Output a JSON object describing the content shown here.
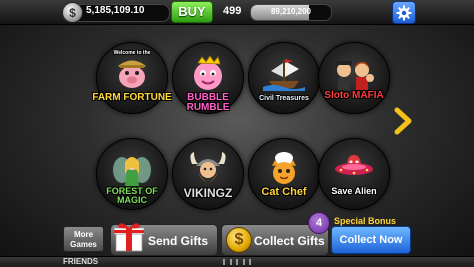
{
  "top_bar": {
    "coins": "5,185,109.10",
    "buy_label": "BUY",
    "level": "499",
    "xp_value": "89,210,200",
    "xp_progress": 0.72
  },
  "games": [
    {
      "title": "FARM FORTUNE",
      "subtitle": "Welcome to the",
      "title_color": "#ffdb3a",
      "icon": "pig-farmer-icon"
    },
    {
      "title": "BUBBLE RUMBLE",
      "title_color": "#ff5fc8",
      "icon": "pink-bubble-character-icon"
    },
    {
      "title": "Civil Treasures",
      "title_color": "#e8f4ff",
      "icon": "sailing-ship-icon"
    },
    {
      "title": "Sloto MAFIA",
      "title_color": "#ff3a3a",
      "icon": "mafia-characters-icon"
    },
    {
      "title": "FOREST OF MAGIC",
      "title_color": "#7fe05a",
      "icon": "fairy-icon"
    },
    {
      "title": "VIKINGZ",
      "title_color": "#e0e0e0",
      "icon": "viking-icon"
    },
    {
      "title": "Cat Chef",
      "title_color": "#ffd43a",
      "icon": "cat-chef-icon"
    },
    {
      "title": "Save Alien",
      "title_color": "#ffffff",
      "icon": "alien-saucer-icon"
    }
  ],
  "bottom_bar": {
    "more_games_line1": "More",
    "more_games_line2": "Games",
    "send_gifts_label": "Send Gifts",
    "collect_gifts_label": "Collect Gifts",
    "collect_gifts_symbol": "$",
    "gift_count": "4",
    "special_bonus_label": "Special Bonus",
    "collect_now_label": "Collect Now"
  },
  "friends_bar": {
    "label": "FRIENDS"
  },
  "colors": {
    "buy_green": "#2e9c10",
    "accent_blue": "#1c63d8",
    "bonus_yellow": "#ffd43a",
    "badge_purple": "#6a2fa3"
  }
}
